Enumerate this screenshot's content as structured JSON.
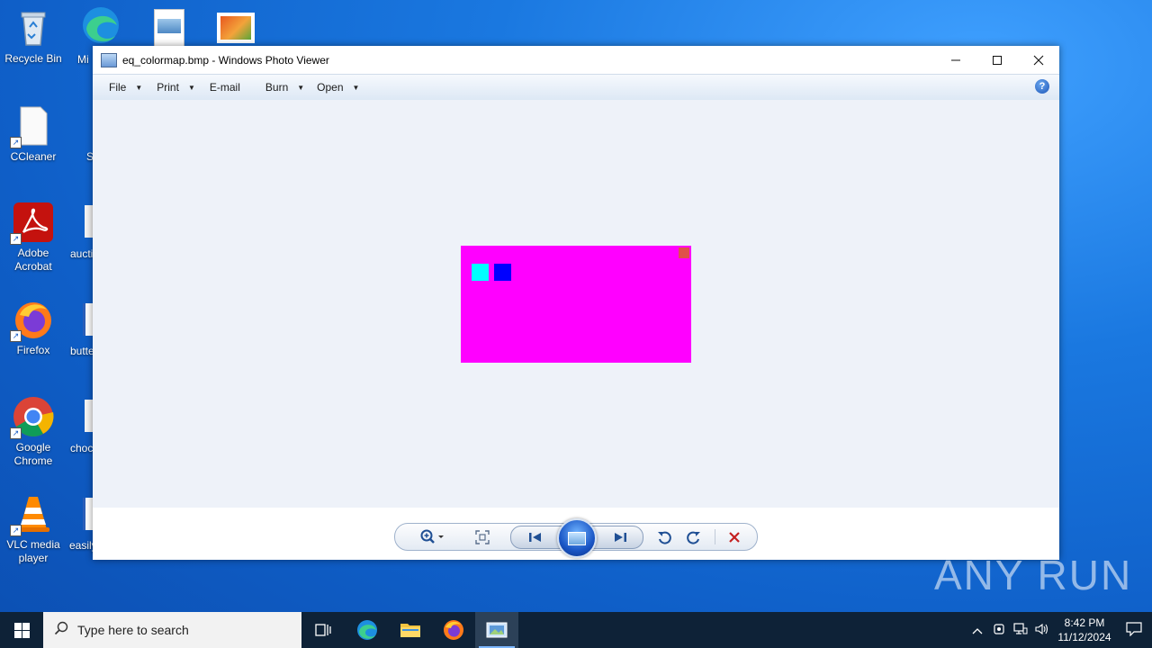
{
  "desktop": {
    "icons": [
      {
        "label": "Recycle Bin"
      },
      {
        "label": "CCleaner"
      },
      {
        "label": "Adobe Acrobat"
      },
      {
        "label": "Firefox"
      },
      {
        "label": "Google Chrome"
      },
      {
        "label": "VLC media player"
      }
    ],
    "partial_labels": [
      "Mi",
      "S",
      "auctio",
      "butte",
      "choc",
      "easily"
    ]
  },
  "window": {
    "title": "eq_colormap.bmp - Windows Photo Viewer",
    "menu": [
      {
        "label": "File",
        "has_dropdown": true
      },
      {
        "label": "Print",
        "has_dropdown": true
      },
      {
        "label": "E-mail",
        "has_dropdown": false
      },
      {
        "label": "Burn",
        "has_dropdown": true
      },
      {
        "label": "Open",
        "has_dropdown": true
      }
    ],
    "help": "?",
    "image": {
      "background": "#ff00ff",
      "squares": [
        "#00ffff",
        "#0000ff",
        "#e0504a"
      ]
    },
    "controls": [
      "zoom-icon",
      "actual-size-icon",
      "previous-icon",
      "slideshow-icon",
      "next-icon",
      "rotate-left-icon",
      "rotate-right-icon",
      "delete-icon"
    ]
  },
  "watermark": "ANY RUN",
  "taskbar": {
    "search_placeholder": "Type here to search",
    "time": "8:42 PM",
    "date": "11/12/2024"
  }
}
